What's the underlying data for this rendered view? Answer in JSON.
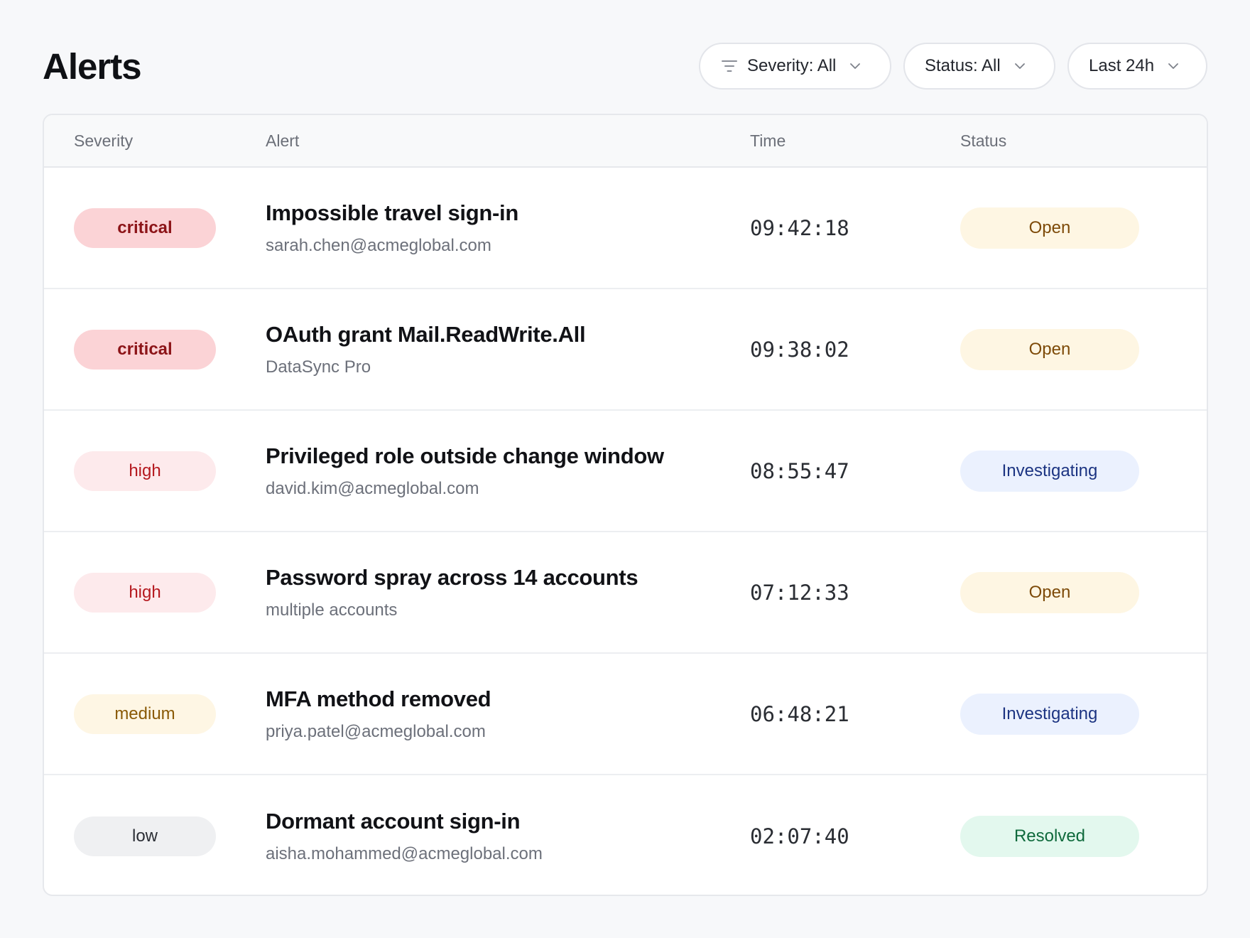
{
  "header": {
    "title": "Alerts"
  },
  "filters": {
    "severity": {
      "label": "Severity: All",
      "icon": "filter-icon"
    },
    "status": {
      "label": "Status: All"
    },
    "time_range": {
      "label": "Last 24h"
    }
  },
  "table": {
    "columns": [
      "Severity",
      "Alert",
      "Time",
      "Status"
    ],
    "rows": [
      {
        "severity": "critical",
        "title": "Impossible travel sign-in",
        "subject": "sarah.chen@acmeglobal.com",
        "time": "09:42:18",
        "status": "Open"
      },
      {
        "severity": "critical",
        "title": "OAuth grant Mail.ReadWrite.All",
        "subject": "DataSync Pro",
        "time": "09:38:02",
        "status": "Open"
      },
      {
        "severity": "high",
        "title": "Privileged role outside change window",
        "subject": "david.kim@acmeglobal.com",
        "time": "08:55:47",
        "status": "Investigating"
      },
      {
        "severity": "high",
        "title": "Password spray across 14 accounts",
        "subject": "multiple accounts",
        "time": "07:12:33",
        "status": "Open"
      },
      {
        "severity": "medium",
        "title": "MFA method removed",
        "subject": "priya.patel@acmeglobal.com",
        "time": "06:48:21",
        "status": "Investigating"
      },
      {
        "severity": "low",
        "title": "Dormant account sign-in",
        "subject": "aisha.mohammed@acmeglobal.com",
        "time": "02:07:40",
        "status": "Resolved"
      }
    ]
  },
  "colors": {
    "background": "#f7f8fa",
    "critical_bg": "#fbd3d6",
    "high_bg": "#fdeaec",
    "medium_bg": "#fef6e4",
    "low_bg": "#eff0f2",
    "open_bg": "#fef6e3",
    "investigating_bg": "#ebf1fe",
    "resolved_bg": "#e3f8ee"
  }
}
